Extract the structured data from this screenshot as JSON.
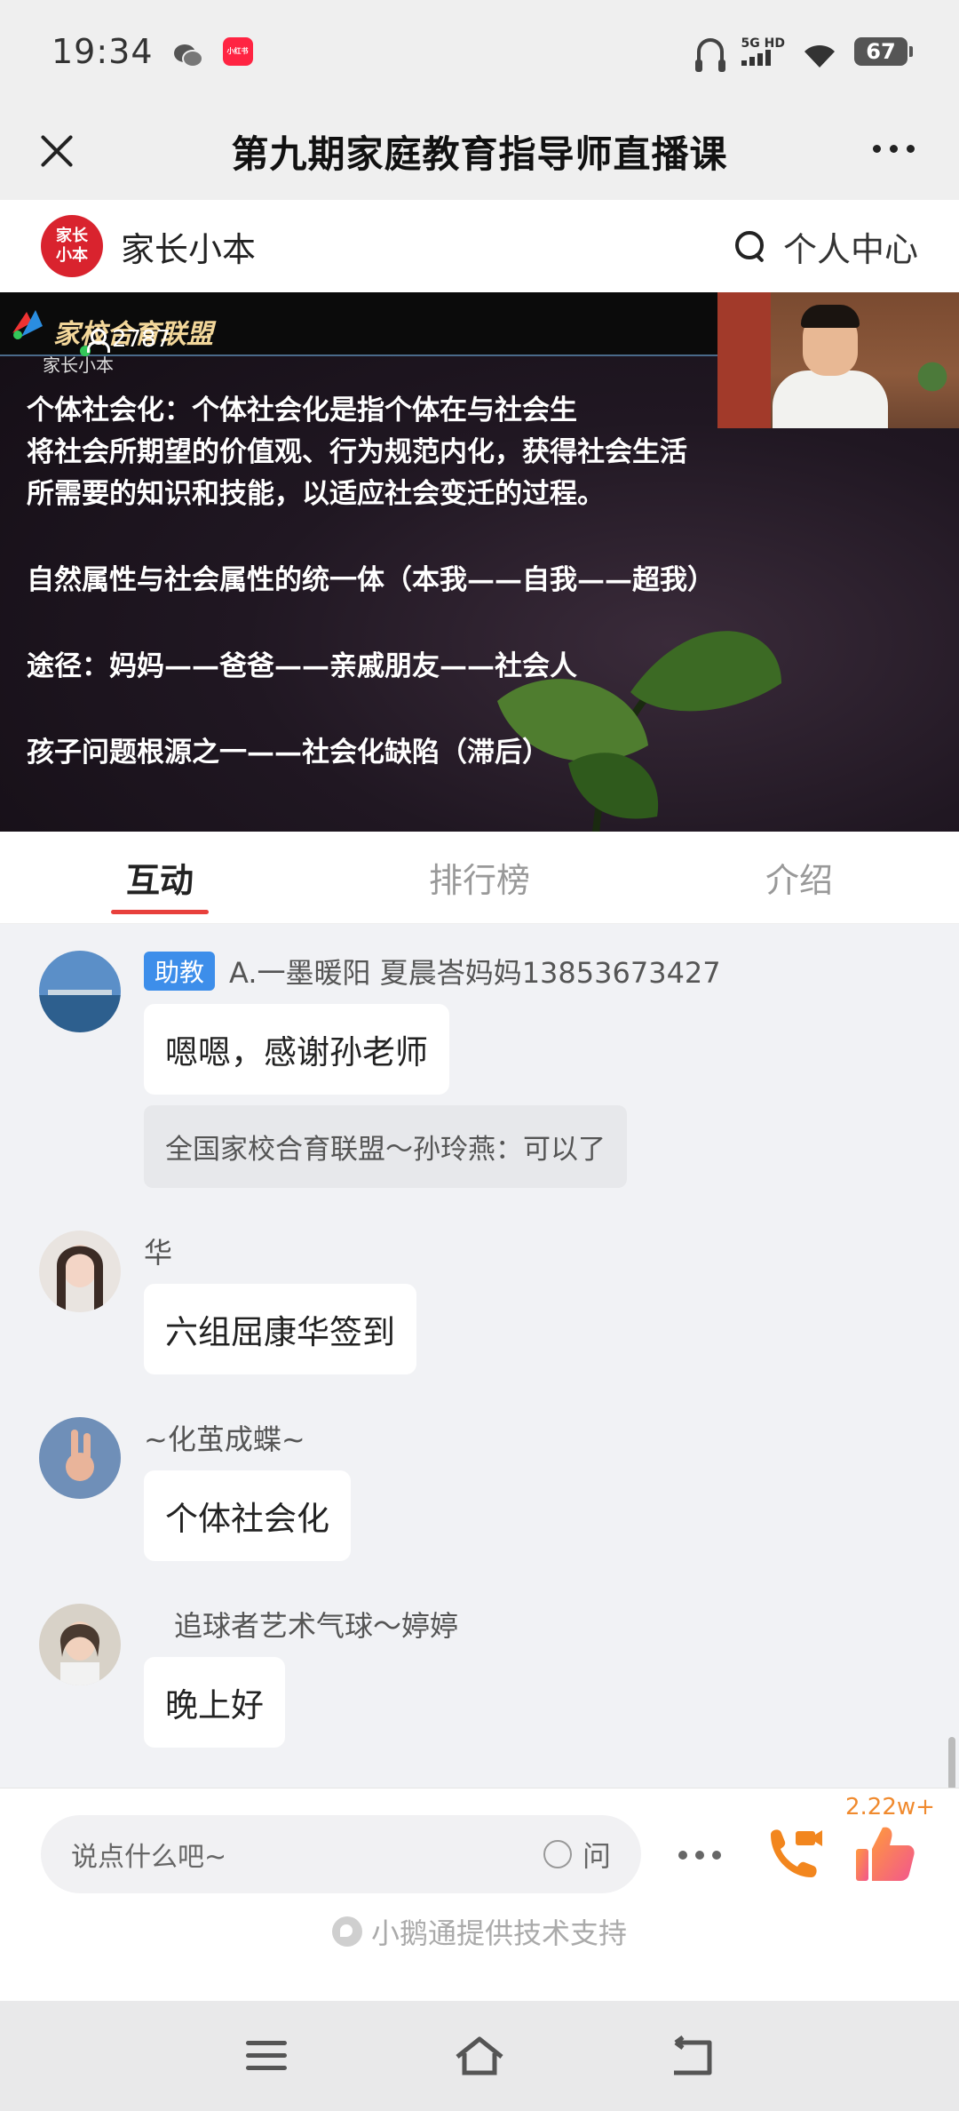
{
  "status": {
    "time": "19:34",
    "app_badge": "小红书",
    "network": "5G HD",
    "battery": "67"
  },
  "titlebar": {
    "title": "第九期家庭教育指导师直播课"
  },
  "brand": {
    "logo_line1": "家长",
    "logo_line2": "小本",
    "name": "家长小本",
    "personal_center": "个人中心"
  },
  "video": {
    "org_name": "家校合育联盟",
    "channel": "家长小本",
    "viewer_count": "2787",
    "slide_lines": [
      "个体社会化：个体社会化是指个体在与社会生",
      "将社会所期望的价值观、行为规范内化，获得社会生活",
      "所需要的知识和技能，以适应社会变迁的过程。",
      "自然属性与社会属性的统一体（本我——自我——超我）",
      "途径：妈妈——爸爸——亲戚朋友——社会人",
      "孩子问题根源之一——社会化缺陷（滞后）"
    ]
  },
  "tabs": [
    {
      "label": "互动",
      "active": true
    },
    {
      "label": "排行榜",
      "active": false
    },
    {
      "label": "介绍",
      "active": false
    }
  ],
  "messages": [
    {
      "badge": "助教",
      "name": "A.一墨暖阳 夏晨峇妈妈13853673427",
      "text": "嗯嗯，感谢孙老师",
      "quote": "全国家校合育联盟～孙玲燕：可以了"
    },
    {
      "name": "华",
      "text": "六组屈康华签到"
    },
    {
      "name": "~化茧成蝶~",
      "text": "个体社会化"
    },
    {
      "name": "追球者艺术气球～婷婷",
      "text": "晚上好"
    }
  ],
  "input": {
    "placeholder": "说点什么吧~",
    "ask_label": "问",
    "like_count": "2.22w+",
    "tech_support": "小鹅通提供技术支持"
  },
  "colors": {
    "accent_red": "#e8403c",
    "badge_blue": "#3d8eea",
    "like_orange": "#f08a2e"
  }
}
